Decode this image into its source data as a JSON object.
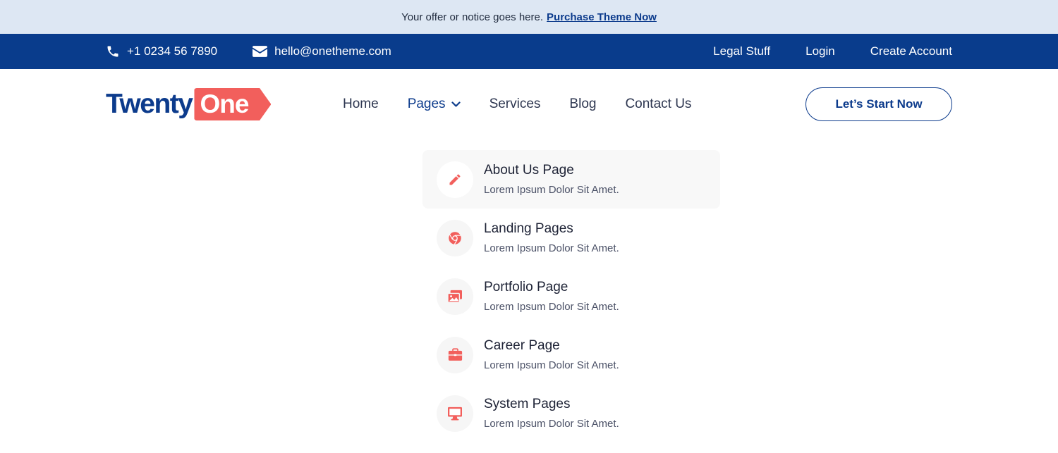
{
  "notice": {
    "text": "Your offer or notice goes here.",
    "link_label": "Purchase Theme Now"
  },
  "contact": {
    "phone": "+1 0234 56 7890",
    "email": "hello@onetheme.com",
    "links": [
      "Legal Stuff",
      "Login",
      "Create Account"
    ]
  },
  "logo": {
    "part1": "Twenty",
    "part2": "One"
  },
  "nav": {
    "items": [
      "Home",
      "Pages",
      "Services",
      "Blog",
      "Contact Us"
    ],
    "active": "Pages"
  },
  "cta": {
    "label": "Let’s Start Now"
  },
  "dropdown": {
    "items": [
      {
        "title": "About Us Page",
        "desc": "Lorem Ipsum Dolor Sit Amet.",
        "icon": "pencil-icon"
      },
      {
        "title": "Landing Pages",
        "desc": "Lorem Ipsum Dolor Sit Amet.",
        "icon": "chrome-icon"
      },
      {
        "title": "Portfolio Page",
        "desc": "Lorem Ipsum Dolor Sit Amet.",
        "icon": "images-icon"
      },
      {
        "title": "Career Page",
        "desc": "Lorem Ipsum Dolor Sit Amet.",
        "icon": "briefcase-icon"
      },
      {
        "title": "System Pages",
        "desc": "Lorem Ipsum Dolor Sit Amet.",
        "icon": "desktop-icon"
      }
    ]
  },
  "colors": {
    "brand_blue": "#0c3b8c",
    "accent_red": "#f25f5c",
    "notice_bg": "#dde7f3"
  }
}
